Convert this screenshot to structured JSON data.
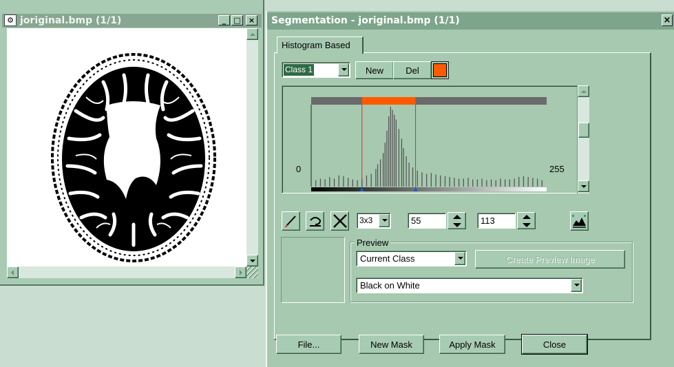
{
  "left_window": {
    "title": "joriginal.bmp (1/1)",
    "minimize": "_",
    "maximize": "□",
    "close": "×"
  },
  "seg_window": {
    "title": "Segmentation - joriginal.bmp (1/1)",
    "close": "×",
    "tab": "Histogram Based",
    "class_select": "Class 1",
    "new_label": "New",
    "del_label": "Del",
    "class_color": "#ff5a00",
    "histogram": {
      "min_label": "0",
      "max_label": "255",
      "range_low": 55,
      "range_high": 113,
      "highlight_color": "#ff5a00"
    },
    "kernel_select": "3x3",
    "low_value": "55",
    "high_value": "113",
    "preview": {
      "legend": "Preview",
      "mode_select": "Current Class",
      "create_button": "Create Preview Image",
      "render_select": "Black on White"
    },
    "buttons": {
      "file": "File...",
      "new_mask": "New Mask",
      "apply_mask": "Apply Mask",
      "close": "Close"
    }
  },
  "chart_data": {
    "type": "bar",
    "xlim": [
      0,
      255
    ],
    "selected_range": [
      55,
      113
    ],
    "x": [
      5,
      10,
      15,
      20,
      25,
      30,
      35,
      40,
      45,
      50,
      55,
      60,
      65,
      70,
      72,
      75,
      78,
      80,
      82,
      84,
      86,
      88,
      90,
      92,
      95,
      98,
      100,
      103,
      106,
      110,
      115,
      120,
      125,
      130,
      135,
      140,
      145,
      150,
      155,
      160,
      165,
      170,
      175,
      180,
      185,
      190,
      195,
      200,
      205,
      210,
      215,
      220,
      225,
      230,
      235,
      240,
      245,
      250
    ],
    "values": [
      8,
      10,
      9,
      12,
      10,
      14,
      13,
      11,
      9,
      8,
      10,
      14,
      16,
      22,
      28,
      34,
      42,
      55,
      70,
      88,
      100,
      96,
      90,
      84,
      72,
      60,
      48,
      38,
      30,
      24,
      20,
      18,
      16,
      17,
      15,
      14,
      13,
      12,
      11,
      10,
      10,
      11,
      9,
      9,
      10,
      8,
      9,
      8,
      10,
      9,
      9,
      10,
      12,
      13,
      12,
      11,
      10,
      8
    ]
  }
}
